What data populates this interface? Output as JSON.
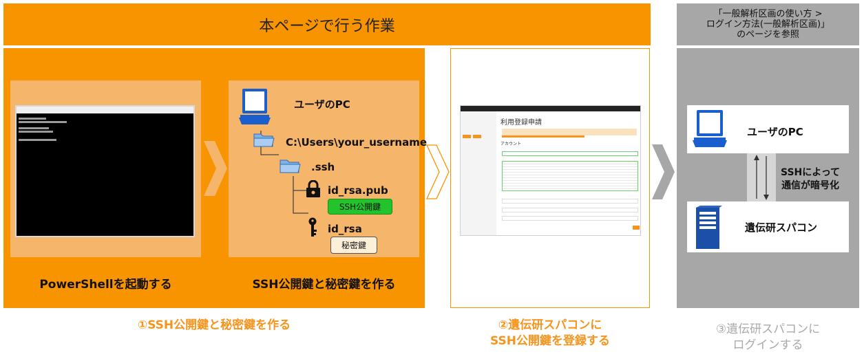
{
  "header": {
    "main_title": "本ページで行う作業",
    "reference_line1": "「一般解析区画の使い方 >",
    "reference_line2": "ログイン方法(一般解析区画)」",
    "reference_line3": "のページを参照"
  },
  "step1": {
    "powershell_caption": "PowerShellを起動する",
    "keygen_caption": "SSH公開鍵と秘密鍵を作る",
    "footer": "①SSH公開鍵と秘密鍵を作る",
    "tree": {
      "pc_label": "ユーザのPC",
      "home_dir": "C:\\Users\\your_username",
      "ssh_dir": ".ssh",
      "pub_file": "id_rsa.pub",
      "pub_badge": "SSH公開鍵",
      "priv_file": "id_rsa",
      "priv_badge": "秘密鍵"
    }
  },
  "step2": {
    "footer_line1": "②遺伝研スパコンに",
    "footer_line2": "SSH公開鍵を登録する",
    "form_title": "利用登録申請",
    "form_section": "アカウント"
  },
  "step3": {
    "pc_label": "ユーザのPC",
    "server_label": "遺伝研スパコン",
    "encrypt_line1": "SSHによって",
    "encrypt_line2": "通信が暗号化",
    "footer_line1": "③遺伝研スパコンに",
    "footer_line2": "ログインする"
  },
  "colors": {
    "orange": "#f79400",
    "light_orange": "#f5b56b",
    "gray": "#a7a7a7",
    "green_badge": "#22c32b",
    "laptop_blue": "#1b5fcf"
  }
}
